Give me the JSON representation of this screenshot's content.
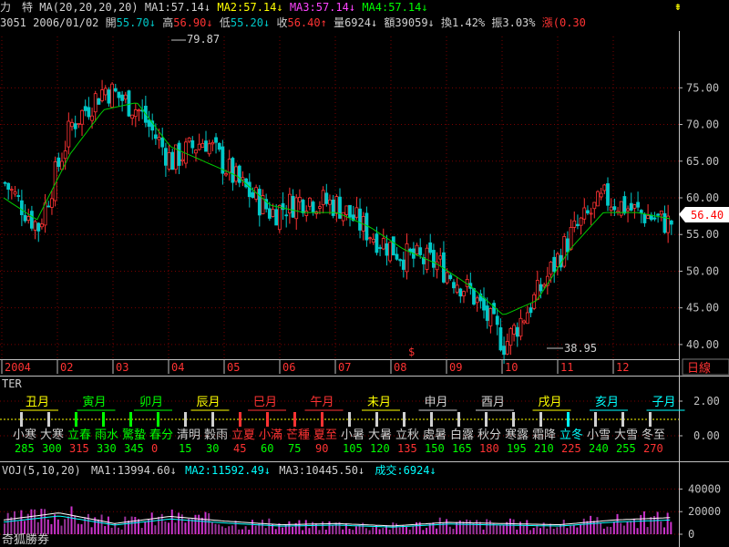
{
  "header": {
    "stock_name": "力　特",
    "ma_label": "MA(20,20,20,20)",
    "ma1": "MA1:57.14↓",
    "ma2": "MA2:57.14↓",
    "ma3": "MA3:57.14↓",
    "ma4": "MA4:57.14↓",
    "code": "3051",
    "date": "2006/01/02",
    "open_label": "開",
    "open_value": "55.70↓",
    "high_label": "高",
    "high_value": "56.90↓",
    "low_label": "低",
    "low_value": "55.20↓",
    "close_label": "收",
    "close_value": "56.40↑",
    "volume": "量6924↓",
    "amount": "額39059↓",
    "turnover": "換1.42%",
    "amplitude": "振3.03%",
    "change_label": "漲",
    "change_value": "(0.30"
  },
  "main": {
    "current_price": "56.40",
    "peak_label": "79.87",
    "trough_label": "38.95",
    "y_ticks": [
      "75.00",
      "70.00",
      "65.00",
      "60.00",
      "55.00",
      "50.00",
      "45.00",
      "40.00"
    ],
    "x_labels": [
      "2004",
      "02",
      "03",
      "04",
      "05",
      "06",
      "07",
      "08",
      "09",
      "10",
      "11",
      "12"
    ],
    "period_button": "日線",
    "dollar_marker": "$",
    "scroll_top_icon": "⇟"
  },
  "indicator": {
    "name": "TER",
    "y_ticks": [
      "2.00",
      "0.00"
    ],
    "months": [
      {
        "text": "丑月",
        "color": "#ffff00"
      },
      {
        "text": "寅月",
        "color": "#00ff00"
      },
      {
        "text": "卯月",
        "color": "#00ff00"
      },
      {
        "text": "辰月",
        "color": "#ffff00"
      },
      {
        "text": "巳月",
        "color": "#ff3333"
      },
      {
        "text": "午月",
        "color": "#ff3333"
      },
      {
        "text": "未月",
        "color": "#ffff00"
      },
      {
        "text": "申月",
        "color": "#d0d0d0"
      },
      {
        "text": "酉月",
        "color": "#d0d0d0"
      },
      {
        "text": "戌月",
        "color": "#ffff00"
      },
      {
        "text": "亥月",
        "color": "#00ffff"
      },
      {
        "text": "子月",
        "color": "#00ffff"
      }
    ],
    "terms": [
      {
        "text": "小寒",
        "color": "#d0d0d0"
      },
      {
        "text": "大寒",
        "color": "#d0d0d0"
      },
      {
        "text": "立春",
        "color": "#00ff00"
      },
      {
        "text": "雨水",
        "color": "#00ff00"
      },
      {
        "text": "驚蟄",
        "color": "#00ff00"
      },
      {
        "text": "春分",
        "color": "#00ff00"
      },
      {
        "text": "清明",
        "color": "#d0d0d0"
      },
      {
        "text": "穀雨",
        "color": "#d0d0d0"
      },
      {
        "text": "立夏",
        "color": "#ff3333"
      },
      {
        "text": "小滿",
        "color": "#ff3333"
      },
      {
        "text": "芒種",
        "color": "#ff3333"
      },
      {
        "text": "夏至",
        "color": "#ff3333"
      },
      {
        "text": "小暑",
        "color": "#d0d0d0"
      },
      {
        "text": "大暑",
        "color": "#d0d0d0"
      },
      {
        "text": "立秋",
        "color": "#d0d0d0"
      },
      {
        "text": "處暑",
        "color": "#d0d0d0"
      },
      {
        "text": "白露",
        "color": "#d0d0d0"
      },
      {
        "text": "秋分",
        "color": "#d0d0d0"
      },
      {
        "text": "寒露",
        "color": "#d0d0d0"
      },
      {
        "text": "霜降",
        "color": "#d0d0d0"
      },
      {
        "text": "立冬",
        "color": "#00ffff"
      },
      {
        "text": "小雪",
        "color": "#d0d0d0"
      },
      {
        "text": "大雪",
        "color": "#d0d0d0"
      },
      {
        "text": "冬至",
        "color": "#d0d0d0"
      }
    ],
    "degrees": [
      {
        "text": "285",
        "color": "#00ff00"
      },
      {
        "text": "300",
        "color": "#00ff00"
      },
      {
        "text": "315",
        "color": "#ff3333"
      },
      {
        "text": "330",
        "color": "#00ff00"
      },
      {
        "text": "345",
        "color": "#00ff00"
      },
      {
        "text": "0",
        "color": "#ff3333"
      },
      {
        "text": "15",
        "color": "#00ff00"
      },
      {
        "text": "30",
        "color": "#00ff00"
      },
      {
        "text": "45",
        "color": "#ff3333"
      },
      {
        "text": "60",
        "color": "#00ff00"
      },
      {
        "text": "75",
        "color": "#00ff00"
      },
      {
        "text": "90",
        "color": "#ff3333"
      },
      {
        "text": "105",
        "color": "#00ff00"
      },
      {
        "text": "120",
        "color": "#00ff00"
      },
      {
        "text": "135",
        "color": "#ff3333"
      },
      {
        "text": "150",
        "color": "#00ff00"
      },
      {
        "text": "165",
        "color": "#00ff00"
      },
      {
        "text": "180",
        "color": "#ff3333"
      },
      {
        "text": "195",
        "color": "#00ff00"
      },
      {
        "text": "210",
        "color": "#00ff00"
      },
      {
        "text": "225",
        "color": "#ff3333"
      },
      {
        "text": "240",
        "color": "#00ff00"
      },
      {
        "text": "255",
        "color": "#00ff00"
      },
      {
        "text": "270",
        "color": "#ff3333"
      }
    ]
  },
  "volume": {
    "label": "VOJ(5,10,20)",
    "ma1": "MA1:13994.60↓",
    "ma2": "MA2:11592.49↓",
    "ma3": "MA3:10445.50↓",
    "volume": "成交:6924↓",
    "y_ticks": [
      "40000",
      "20000",
      "0"
    ],
    "watermark": "奇狐勝券"
  },
  "colors": {
    "background": "#000000",
    "grid": "#7a0000",
    "axis": "#c0c0c0",
    "up_candle": "#ff3333",
    "down_candle": "#00c8c8",
    "ma_line": "#00cc00"
  },
  "chart_data": [
    {
      "type": "candlestick",
      "title": "力 特 3051",
      "xlabel": "",
      "ylabel": "",
      "ylim": [
        38,
        82
      ],
      "x_ticks": [
        "2004",
        "02",
        "03",
        "04",
        "05",
        "06",
        "07",
        "08",
        "09",
        "10",
        "11",
        "12"
      ],
      "ma_series_name": "MA(20)",
      "x_start_month": 1,
      "monthly_closes": [
        62,
        56,
        70,
        75,
        72,
        65,
        68,
        62,
        58,
        60,
        59,
        55,
        52,
        51,
        47,
        40,
        47,
        55,
        60,
        58,
        56.4
      ],
      "ma_monthly": [
        60,
        57,
        66,
        72,
        73,
        67,
        65,
        63,
        59,
        58,
        58,
        56,
        53,
        51,
        48,
        44,
        46,
        53,
        58,
        58,
        57.14
      ],
      "peak": 79.87,
      "trough": 38.95,
      "last_close": 56.4
    },
    {
      "type": "bar",
      "title": "VOJ(5,10,20)",
      "ylim": [
        0,
        50000
      ],
      "values_approx": [
        12000,
        18000,
        9000,
        15000,
        11000,
        8000,
        9000,
        7000,
        10000,
        9000,
        8000,
        12000,
        13994
      ],
      "series": [
        {
          "name": "MA1",
          "last": 13994.6
        },
        {
          "name": "MA2",
          "last": 11592.49
        },
        {
          "name": "MA3",
          "last": 10445.5
        }
      ]
    }
  ]
}
